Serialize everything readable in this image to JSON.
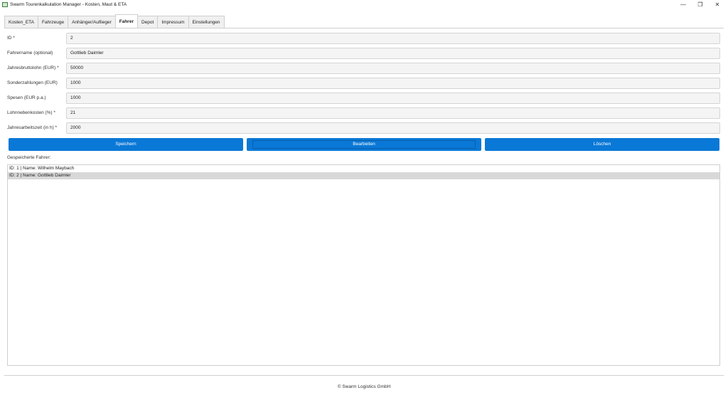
{
  "window": {
    "title": "Swarm Tourenkalkulation Manager - Kosten, Maut & ETA",
    "minimize": "—",
    "restore": "❐",
    "close": "✕"
  },
  "tabs": [
    {
      "label": "Kosten_ETA"
    },
    {
      "label": "Fahrzeuge"
    },
    {
      "label": "Anhänger/Auflieger"
    },
    {
      "label": "Fahrer"
    },
    {
      "label": "Depot"
    },
    {
      "label": "Impressum"
    },
    {
      "label": "Einstellungen"
    }
  ],
  "active_tab": "Fahrer",
  "form": {
    "id": {
      "label": "ID *",
      "value": "2"
    },
    "name": {
      "label": "Fahrername (optional)",
      "value": "Gottlieb Daimler"
    },
    "salary": {
      "label": "Jahresbruttolohn (EUR) *",
      "value": "50000"
    },
    "special": {
      "label": "Sonderzahlungen (EUR)",
      "value": "1000"
    },
    "expenses": {
      "label": "Spesen (EUR p.a.)",
      "value": "1000"
    },
    "ancillary": {
      "label": "Lohnnebenkosten (%) *",
      "value": "21"
    },
    "hours": {
      "label": "Jahresarbeitszeit (in h) *",
      "value": "2000"
    }
  },
  "buttons": {
    "save": "Speichern",
    "edit": "Bearbeiten",
    "delete": "Löschen"
  },
  "list": {
    "label": "Gespeicherte Fahrer:",
    "items": [
      {
        "text": "ID: 1 | Name: Wilhelm Maybach",
        "selected": false
      },
      {
        "text": "ID: 2 | Name: Gottlieb Daimler",
        "selected": true
      }
    ]
  },
  "footer": "© Swarm Logistics GmbH"
}
